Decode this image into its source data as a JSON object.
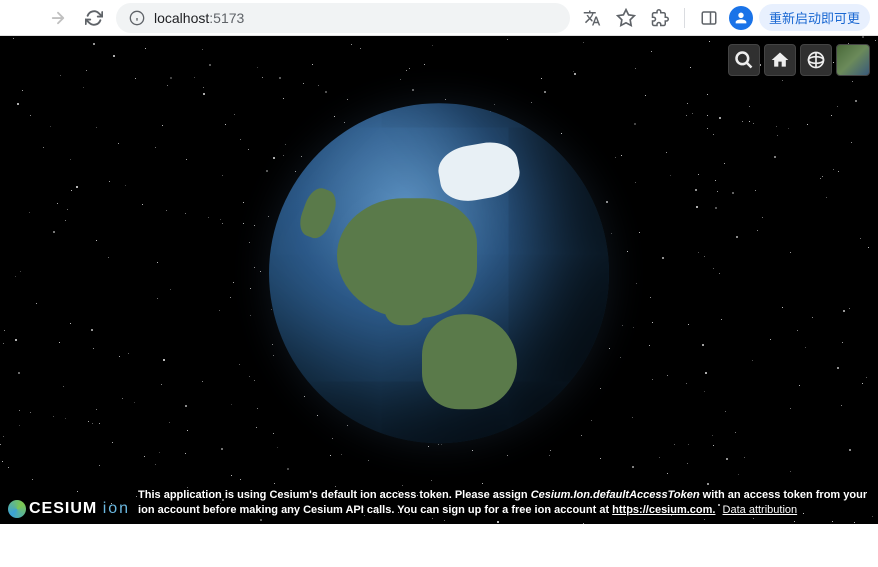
{
  "browser": {
    "url_host": "localhost",
    "url_port": ":5173",
    "restart_label": "重新启动即可更"
  },
  "cesium": {
    "logo_brand": "CESIUM",
    "logo_sub": "ion",
    "msg_pre": "This application is using Cesium's default ion access token. Please assign ",
    "msg_token_var": "Cesium.Ion.defaultAccessToken",
    "msg_mid": " with an access token from your ion account before making any Cesium API calls. You can sign up for a free ion account at ",
    "msg_link": "https://cesium.com.",
    "msg_attrib": "Data attribution"
  }
}
